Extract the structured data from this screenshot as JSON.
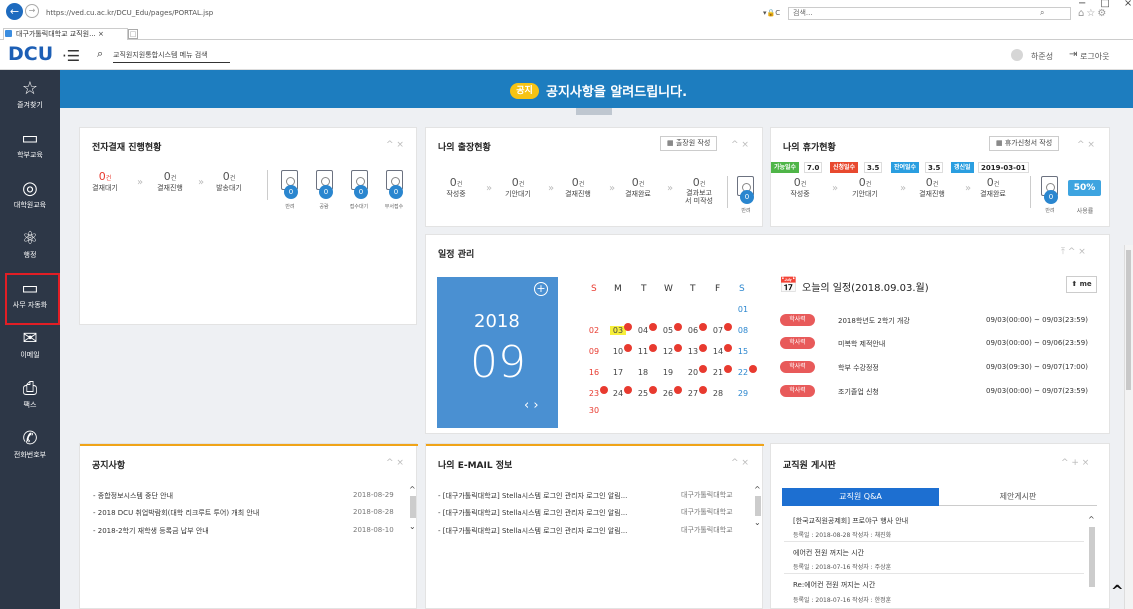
{
  "browser": {
    "url": "https://ved.cu.ac.kr/DCU_Edu/pages/PORTAL.jsp",
    "url_icons": "▾🔒C",
    "search_placeholder": "검색...",
    "window_controls": "−□×",
    "tab_title": "대구가톨릭대학교 교직원...",
    "tab_close": "×"
  },
  "app": {
    "logo": "DCU",
    "menu_search": "교직원지원통합시스템 메뉴 검색",
    "user_name": "하준성",
    "logout": "로그아웃"
  },
  "sidebar": {
    "items": [
      {
        "icon": "☆",
        "label": "즐겨찾기"
      },
      {
        "icon": "▭",
        "label": "학부교육"
      },
      {
        "icon": "◎",
        "label": "대학원교육"
      },
      {
        "icon": "⚛",
        "label": "행정"
      },
      {
        "icon": "▭",
        "label": "사무 자동화"
      },
      {
        "icon": "✉",
        "label": "이메일"
      },
      {
        "icon": "⎙",
        "label": "팩스"
      },
      {
        "icon": "✆",
        "label": "전화번호부"
      }
    ]
  },
  "banner": {
    "badge": "공지",
    "text": "공지사항을 알려드립니다."
  },
  "approval": {
    "title": "전자결재 진행현황",
    "counts": [
      {
        "n": "0",
        "unit": "건",
        "label": "결재대기"
      },
      {
        "n": "0",
        "unit": "건",
        "label": "결재진행"
      },
      {
        "n": "0",
        "unit": "건",
        "label": "발송대기"
      }
    ],
    "docs": [
      {
        "badge": "0",
        "label": "반려"
      },
      {
        "badge": "0",
        "label": "공람"
      },
      {
        "badge": "0",
        "label": "접수대기"
      },
      {
        "badge": "0",
        "label": "부서접수"
      }
    ]
  },
  "trip": {
    "title": "나의 출장현황",
    "button": "출장원 작성",
    "counts": [
      {
        "n": "0",
        "unit": "건",
        "label": "작성중"
      },
      {
        "n": "0",
        "unit": "건",
        "label": "기안대기"
      },
      {
        "n": "0",
        "unit": "건",
        "label": "결재진행"
      },
      {
        "n": "0",
        "unit": "건",
        "label": "결재완료"
      },
      {
        "n": "0",
        "unit": "건",
        "label": "결과보고서 미작성"
      }
    ],
    "doc": {
      "badge": "0",
      "label": "반려"
    }
  },
  "vacation": {
    "title": "나의 휴가현황",
    "button": "휴가신청서 작성",
    "tags": [
      {
        "label": "가능일수",
        "value": "7.0",
        "color": "#4fb548"
      },
      {
        "label": "신청일수",
        "value": "3.5",
        "color": "#e8492f"
      },
      {
        "label": "잔여일수",
        "value": "3.5",
        "color": "#2a9ee0"
      },
      {
        "label": "갱신일",
        "value": "2019-03-01",
        "color": "#2a9ee0"
      }
    ],
    "counts": [
      {
        "n": "0",
        "unit": "건",
        "label": "작성중"
      },
      {
        "n": "0",
        "unit": "건",
        "label": "기안대기"
      },
      {
        "n": "0",
        "unit": "건",
        "label": "결재진행"
      },
      {
        "n": "0",
        "unit": "건",
        "label": "결재완료"
      }
    ],
    "doc": {
      "badge": "0",
      "label": "반려"
    },
    "usage_pct": "50%",
    "usage_label": "사용률"
  },
  "schedule": {
    "title": "일정 관리",
    "year": "2018",
    "month": "09",
    "plus": "+",
    "nav": "‹ ›",
    "weekdays": [
      "S",
      "M",
      "T",
      "W",
      "T",
      "F",
      "S"
    ],
    "today_title": "오늘의 일정(2018.09.03.월)",
    "me_button": "me",
    "events": [
      {
        "tag": "학사력",
        "title": "2018학년도 2학기 개강",
        "time": "09/03(00:00) ~ 09/03(23:59)"
      },
      {
        "tag": "학사력",
        "title": "미복학 제적안내",
        "time": "09/03(00:00) ~ 09/06(23:59)"
      },
      {
        "tag": "학사력",
        "title": "학부 수강정정",
        "time": "09/03(09:30) ~ 09/07(17:00)"
      },
      {
        "tag": "학사력",
        "title": "조기졸업 신청",
        "time": "09/03(00:00) ~ 09/07(23:59)"
      }
    ]
  },
  "notices": {
    "title": "공지사항",
    "rows": [
      {
        "title": "- 종합정보시스템 중단 안내",
        "date": "2018-08-29"
      },
      {
        "title": "- 2018 DCU 취업박람회(대학 리크루트 투어) 개최 안내",
        "date": "2018-08-28"
      },
      {
        "title": "- 2018-2학기 재학생 등록금 납부 안내",
        "date": "2018-08-10"
      }
    ]
  },
  "email": {
    "title": "나의 E-MAIL 정보",
    "rows": [
      {
        "title": "- [대구가톨릭대학교] Stella시스템 로그인 관리자 로그인 알림...",
        "from": "대구가톨릭대학교"
      },
      {
        "title": "- [대구가톨릭대학교] Stella시스템 로그인 관리자 로그인 알림...",
        "from": "대구가톨릭대학교"
      },
      {
        "title": "- [대구가톨릭대학교] Stella시스템 로그인 관리자 로그인 알림...",
        "from": "대구가톨릭대학교"
      }
    ]
  },
  "board": {
    "title": "교직원 게시판",
    "tab_active": "교직원 Q&A",
    "tab_inactive": "제안게시판",
    "rows": [
      {
        "title": "[한국교직원공제회] 프로야구 행사 안내",
        "meta": "등록일 : 2018-08-28   작성자 : 채진화"
      },
      {
        "title": "에어컨 전원 꺼지는 시간",
        "meta": "등록일 : 2018-07-16   작성자 : 주상훈"
      },
      {
        "title": "Re:에어컨 전원 꺼지는 시간",
        "meta": "등록일 : 2018-07-16   작성자 : 한정훈"
      }
    ]
  }
}
